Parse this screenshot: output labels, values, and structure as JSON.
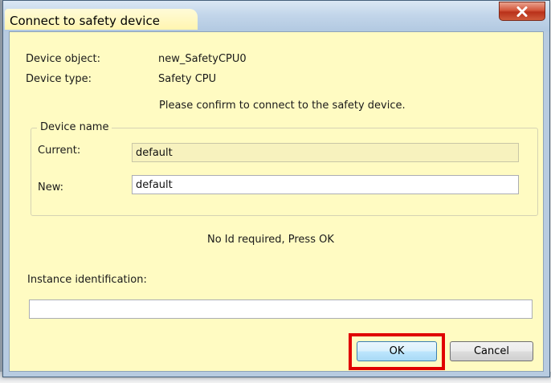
{
  "dialog": {
    "title": "Connect to safety device",
    "close_symbol": "X"
  },
  "info": {
    "device_object_label": "Device object:",
    "device_object_value": "new_SafetyCPU0",
    "device_type_label": "Device type:",
    "device_type_value": "Safety CPU",
    "confirm_message": "Please confirm to connect to the safety device."
  },
  "device_name_group": {
    "legend": "Device name",
    "current_label": "Current:",
    "current_value": "default",
    "new_label": "New:",
    "new_value": "default"
  },
  "status_message": "No Id required, Press OK",
  "instance": {
    "label": "Instance identification:",
    "value": ""
  },
  "buttons": {
    "ok_label": "OK",
    "cancel_label": "Cancel"
  },
  "colors": {
    "client_background": "#fffbc2",
    "highlight_box": "#e00000",
    "close_button": "#c8472a"
  },
  "icons": {
    "close": "close-icon"
  }
}
